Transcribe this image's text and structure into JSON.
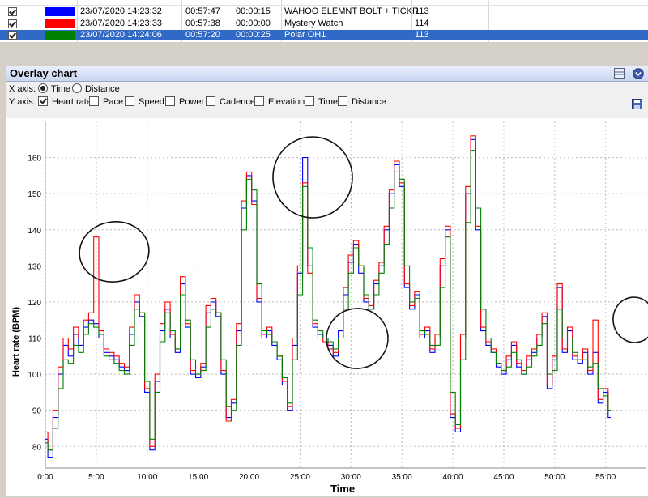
{
  "devices": [
    {
      "date": "23/07/2020 14:23:32",
      "duration": "00:57:47",
      "offset": "00:00:15",
      "name": "WAHOO ELEMNT BOLT + TICKR",
      "avg": "113",
      "color": "#0000ff",
      "selected": false
    },
    {
      "date": "23/07/2020 14:23:33",
      "duration": "00:57:38",
      "offset": "00:00:00",
      "name": "Mystery Watch",
      "avg": "114",
      "color": "#ff0000",
      "selected": false
    },
    {
      "date": "23/07/2020 14:24:06",
      "duration": "00:57:20",
      "offset": "00:00:25",
      "name": "Polar OH1",
      "avg": "113",
      "color": "#008000",
      "selected": true
    }
  ],
  "panel": {
    "title": "Overlay chart",
    "x_axis_label": "X axis:",
    "x_options": [
      {
        "label": "Time",
        "checked": true
      },
      {
        "label": "Distance",
        "checked": false
      }
    ],
    "y_axis_label": "Y axis:",
    "y_options": [
      {
        "label": "Heart rate",
        "checked": true
      },
      {
        "label": "Pace",
        "checked": false
      },
      {
        "label": "Speed",
        "checked": false
      },
      {
        "label": "Power",
        "checked": false
      },
      {
        "label": "Cadence",
        "checked": false
      },
      {
        "label": "Elevation",
        "checked": false
      },
      {
        "label": "Time",
        "checked": false
      },
      {
        "label": "Distance",
        "checked": false
      }
    ]
  },
  "chart_data": {
    "type": "line",
    "xlabel": "Time",
    "ylabel": "Heart rate (BPM)",
    "xlim": [
      0,
      59
    ],
    "ylim": [
      74,
      170
    ],
    "x_ticks": [
      "0:00",
      "5:00",
      "10:00",
      "15:00",
      "20:00",
      "25:00",
      "30:00",
      "35:00",
      "40:00",
      "45:00",
      "50:00",
      "55:00"
    ],
    "y_ticks": [
      80,
      90,
      100,
      110,
      120,
      130,
      140,
      150,
      160
    ],
    "x_minutes": [
      0,
      0.5,
      1,
      1.5,
      2,
      2.5,
      3,
      3.5,
      4,
      4.5,
      5,
      5.5,
      6,
      6.5,
      7,
      7.5,
      8,
      8.5,
      9,
      9.5,
      10,
      10.5,
      11,
      11.5,
      12,
      12.5,
      13,
      13.5,
      14,
      14.5,
      15,
      15.5,
      16,
      16.5,
      17,
      17.5,
      18,
      18.5,
      19,
      19.5,
      20,
      20.5,
      21,
      21.5,
      22,
      22.5,
      23,
      23.5,
      24,
      24.5,
      25,
      25.5,
      26,
      26.5,
      27,
      27.5,
      28,
      28.5,
      29,
      29.5,
      30,
      30.5,
      31,
      31.5,
      32,
      32.5,
      33,
      33.5,
      34,
      34.5,
      35,
      35.5,
      36,
      36.5,
      37,
      37.5,
      38,
      38.5,
      39,
      39.5,
      40,
      40.5,
      41,
      41.5,
      42,
      42.5,
      43,
      43.5,
      44,
      44.5,
      45,
      45.5,
      46,
      46.5,
      47,
      47.5,
      48,
      48.5,
      49,
      49.5,
      50,
      50.5,
      51,
      51.5,
      52,
      52.5,
      53,
      53.5,
      54,
      54.5,
      55,
      55.5,
      56,
      56.5,
      57,
      57.5,
      58
    ],
    "series": [
      {
        "name": "WAHOO ELEMNT BOLT + TICKR",
        "color": "#0000ff",
        "values": [
          82,
          77,
          88,
          100,
          108,
          105,
          111,
          108,
          113,
          115,
          114,
          110,
          106,
          105,
          104,
          102,
          101,
          111,
          120,
          116,
          95,
          79,
          98,
          112,
          118,
          110,
          106,
          125,
          113,
          100,
          99,
          102,
          117,
          120,
          116,
          100,
          88,
          92,
          112,
          146,
          155,
          148,
          120,
          110,
          112,
          108,
          104,
          97,
          90,
          108,
          128,
          160,
          130,
          113,
          111,
          110,
          108,
          105,
          112,
          122,
          131,
          136,
          128,
          120,
          118,
          125,
          130,
          140,
          150,
          158,
          152,
          124,
          118,
          122,
          110,
          112,
          106,
          110,
          130,
          140,
          88,
          84,
          110,
          150,
          165,
          140,
          112,
          108,
          106,
          102,
          100,
          104,
          108,
          102,
          100,
          104,
          106,
          110,
          116,
          96,
          104,
          124,
          106,
          112,
          104,
          103,
          106,
          100,
          106,
          92,
          95,
          88
        ]
      },
      {
        "name": "Mystery Watch",
        "color": "#ff0000",
        "values": [
          84,
          79,
          90,
          102,
          110,
          107,
          113,
          110,
          115,
          117,
          138,
          112,
          107,
          106,
          105,
          103,
          102,
          113,
          122,
          117,
          96,
          80,
          100,
          114,
          120,
          111,
          107,
          127,
          114,
          101,
          100,
          103,
          119,
          121,
          117,
          101,
          87,
          93,
          114,
          148,
          156,
          147,
          121,
          111,
          113,
          109,
          105,
          98,
          91,
          110,
          130,
          153,
          128,
          114,
          110,
          109,
          107,
          106,
          110,
          124,
          133,
          137,
          130,
          121,
          119,
          126,
          131,
          141,
          151,
          159,
          153,
          125,
          119,
          123,
          111,
          113,
          107,
          111,
          132,
          141,
          89,
          85,
          111,
          152,
          166,
          141,
          113,
          109,
          107,
          103,
          101,
          105,
          109,
          103,
          101,
          105,
          107,
          111,
          117,
          97,
          105,
          125,
          107,
          113,
          105,
          104,
          107,
          101,
          115,
          93,
          96,
          90
        ]
      },
      {
        "name": "Polar OH1",
        "color": "#008000",
        "values": [
          81,
          79,
          85,
          96,
          104,
          103,
          108,
          106,
          111,
          114,
          113,
          111,
          105,
          104,
          103,
          101,
          100,
          108,
          118,
          117,
          98,
          82,
          95,
          109,
          117,
          112,
          107,
          122,
          115,
          104,
          100,
          101,
          113,
          118,
          117,
          104,
          91,
          90,
          108,
          140,
          154,
          151,
          125,
          112,
          111,
          109,
          105,
          99,
          92,
          104,
          122,
          152,
          135,
          115,
          112,
          110,
          109,
          107,
          110,
          118,
          128,
          135,
          130,
          122,
          118,
          122,
          128,
          136,
          146,
          156,
          154,
          130,
          120,
          121,
          112,
          111,
          108,
          108,
          124,
          138,
          95,
          86,
          104,
          142,
          162,
          146,
          118,
          110,
          106,
          103,
          101,
          102,
          106,
          104,
          100,
          102,
          105,
          108,
          114,
          100,
          101,
          118,
          110,
          110,
          106,
          104,
          104,
          102,
          103,
          96,
          94,
          90
        ]
      }
    ]
  }
}
